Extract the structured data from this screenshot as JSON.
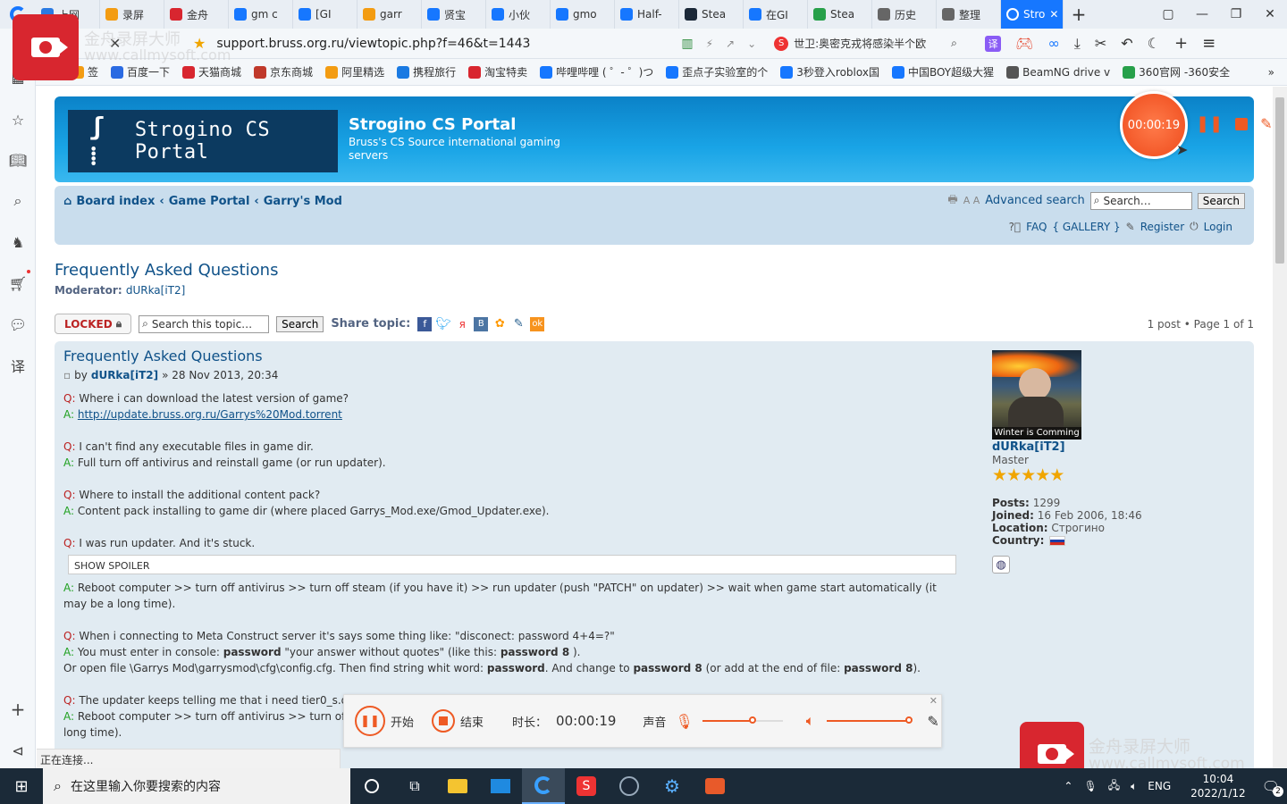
{
  "tabs": [
    {
      "label": "上网",
      "color": "#2a7ae2"
    },
    {
      "label": "录屏",
      "color": "#f39c12"
    },
    {
      "label": "金舟",
      "color": "#d8262f"
    },
    {
      "label": "gm c",
      "color": "#1677ff"
    },
    {
      "label": "[GI",
      "color": "#1677ff"
    },
    {
      "label": "garr",
      "color": "#f39c12"
    },
    {
      "label": "贤宝",
      "color": "#1677ff"
    },
    {
      "label": "小伙",
      "color": "#1677ff"
    },
    {
      "label": "gmo",
      "color": "#1677ff"
    },
    {
      "label": "Half-",
      "color": "#1677ff"
    },
    {
      "label": "Stea",
      "color": "#1b2838"
    },
    {
      "label": "在GI",
      "color": "#1677ff"
    },
    {
      "label": "Stea",
      "color": "#27a04a"
    },
    {
      "label": "历史",
      "color": "#666666"
    },
    {
      "label": "整理",
      "color": "#666666"
    },
    {
      "label": "Stro",
      "color": "#ffffff"
    }
  ],
  "address": {
    "url": "support.bruss.org.ru/viewtopic.php?f=46&t=1443",
    "search_text": "世卫:奥密克戎将感染半个欧"
  },
  "bookmarks": [
    "签",
    "百度一下",
    "天猫商城",
    "京东商城",
    "阿里精选",
    "携程旅行",
    "淘宝特卖",
    "哔哩哔哩 ( ゜- ゜)つ",
    "歪点子实验室的个",
    "3秒登入roblox国",
    "中国BOY超级大猩",
    "BeamNG drive v",
    "360官网 -360安全"
  ],
  "site": {
    "title": "Strogino CS Portal",
    "subtitle": "Bruss's CS Source international gaming servers",
    "logo_text": "Strogino CS Portal"
  },
  "breadcrumb": {
    "board_index": "Board index",
    "game_portal": "Game Portal",
    "garrys_mod": "Garry's Mod"
  },
  "nav": {
    "advanced_search": "Advanced search",
    "search_placeholder": "Search…",
    "search_button": "Search",
    "faq": "FAQ",
    "gallery": "{ GALLERY }",
    "register": "Register",
    "login": "Login",
    "font_size": "A A"
  },
  "forum": {
    "title": "Frequently Asked Questions",
    "moderator_label": "Moderator:",
    "moderator": "dURka[iT2]"
  },
  "topic_tools": {
    "locked": "LOCKED",
    "search_placeholder": "Search this topic…",
    "search_button": "Search",
    "share": "Share topic:",
    "pagination": "1 post • Page 1 of 1"
  },
  "post": {
    "title": "Frequently Asked Questions",
    "by": "by",
    "author": "dURka[iT2]",
    "date": "» 28 Nov 2013, 20:34",
    "q1": "Where i can download the latest version of game?",
    "a1_link": "http://update.bruss.org.ru/Garrys%20Mod.torrent",
    "q2": "I can't find any executable files in game dir.",
    "a2": "Full turn off antivirus and reinstall game (or run updater).",
    "q3": "Where to install the additional content pack?",
    "a3": "Content pack installing to game dir (where placed Garrys_Mod.exe/Gmod_Updater.exe).",
    "q4": "I was run updater. And it's stuck.",
    "spoiler": "SHOW SPOILER",
    "a4": "Reboot computer >> turn off antivirus >> turn off steam (if you have it) >> run updater (push \"PATCH\" on updater) >> wait when game start automatically (it may be a long time).",
    "q5": "When i connecting to Meta Construct server it's says some thing like: \"disconect: password 4+4=?\"",
    "a5_pre": "You must enter in console: ",
    "a5_b1": "password",
    "a5_mid": " \"your answer without quotes\" (like this: ",
    "a5_b2": "password 8",
    "a5_end": " ).",
    "a5b_pre": "Or open file \\Garrys Mod\\garrysmod\\cfg\\config.cfg. Then find string whit word: ",
    "a5b_b1": "password",
    "a5b_mid": ". And change to ",
    "a5b_b2": "password 8",
    "a5b_mid2": " (or add at the end of file: ",
    "a5b_b3": "password 8",
    "a5b_end": ").",
    "q6": "The updater keeps telling me that i need tier0_s.d",
    "a6": "Reboot computer >> turn off antivirus >> turn off s",
    "a6_tail": "long time).",
    "q_label": "Q:",
    "a_label": "A:"
  },
  "profile": {
    "avatar_caption": "Winter is Comming",
    "name": "dURka[iT2]",
    "rank": "Master",
    "rank_stars": 5,
    "posts_label": "Posts:",
    "posts": "1299",
    "joined_label": "Joined:",
    "joined": "16 Feb 2006, 18:46",
    "location_label": "Location:",
    "location": "Строгино",
    "country_label": "Country:"
  },
  "recorder": {
    "timer": "00:00:19",
    "start": "开始",
    "stop": "结束",
    "duration_label": "时长：",
    "duration": "00:00:19",
    "sound_label": "声音"
  },
  "watermark": {
    "brand": "金舟录屏大师",
    "url": "www.callmysoft.com"
  },
  "status_bar": "正在连接...",
  "taskbar": {
    "search_placeholder": "在这里输入你要搜索的内容",
    "lang": "ENG",
    "time": "10:04",
    "date": "2022/1/12",
    "notif": "2"
  }
}
